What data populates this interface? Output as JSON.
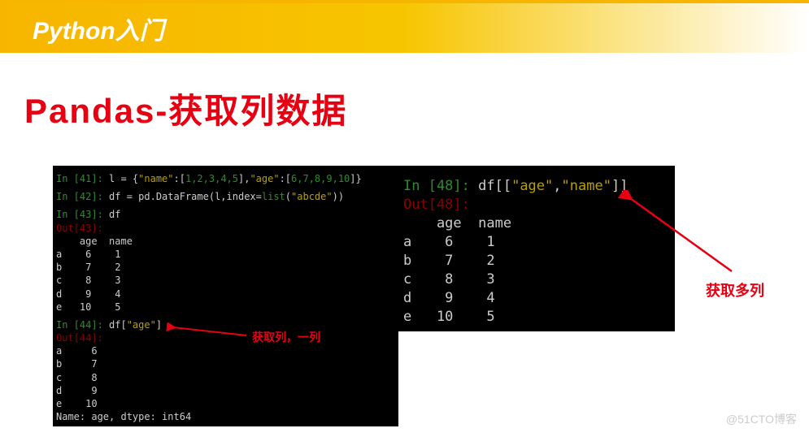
{
  "header": {
    "title": "Python入门"
  },
  "main": {
    "title": "Pandas-获取列数据"
  },
  "code1": {
    "in41_prompt": "In [41]:",
    "in41_body_a": " l = {",
    "in41_name_key": "\"name\"",
    "in41_colon1": ":[",
    "in41_name_vals": "1,2,3,4,5",
    "in41_mid": "],",
    "in41_age_key": "\"age\"",
    "in41_colon2": ":[",
    "in41_age_vals": "6,7,8,9,10",
    "in41_end": "]}",
    "in42_prompt": "In [42]:",
    "in42_body_a": " df = pd.DataFrame(l,index=",
    "in42_list": "list",
    "in42_arg_open": "(",
    "in42_arg": "\"abcde\"",
    "in42_arg_close": "))",
    "in43_prompt": "In [43]:",
    "in43_body": " df",
    "out43_prompt": "Out[43]:",
    "table43": "    age  name\na    6    1\nb    7    2\nc    8    3\nd    9    4\ne   10    5",
    "in44_prompt": "In [44]:",
    "in44_body_a": " df[",
    "in44_key": "\"age\"",
    "in44_body_b": "]",
    "out44_prompt": "Out[44]:",
    "table44": "a     6\nb     7\nc     8\nd     9\ne    10\nName: age, dtype: int64"
  },
  "note1": "获取列，一列",
  "code2": {
    "in48_prompt": "In [48]:",
    "in48_body_a": " df[[",
    "in48_k1": "\"age\"",
    "in48_comma": ",",
    "in48_k2": "\"name\"",
    "in48_body_b": "]]",
    "out48_prompt": "Out[48]:",
    "table48": "    age  name\na    6    1\nb    7    2\nc    8    3\nd    9    4\ne   10    5"
  },
  "note2": "获取多列",
  "watermark": "@51CTO博客"
}
